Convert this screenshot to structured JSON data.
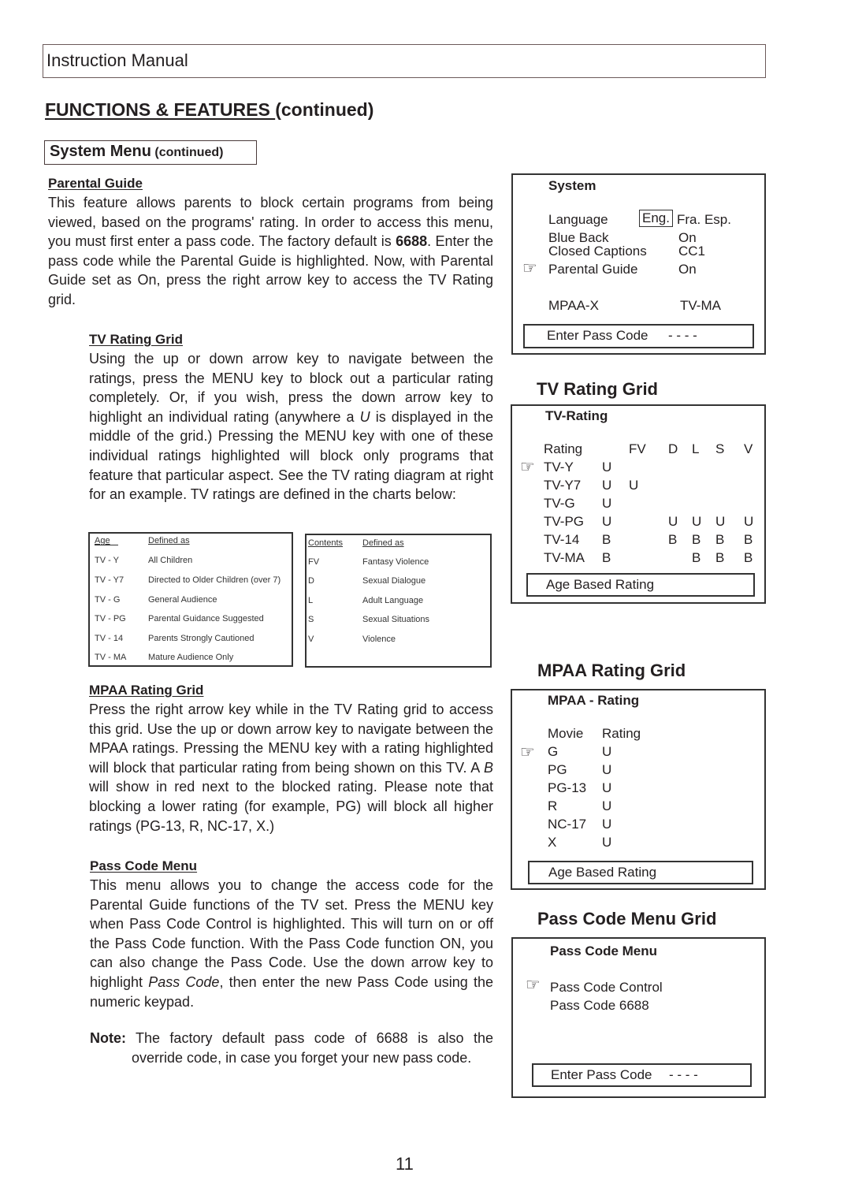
{
  "header": {
    "title": "Instruction Manual"
  },
  "page_title": {
    "main": "FUNCTIONS & FEATURES ",
    "suffix": "(continued)"
  },
  "section": {
    "title": "System Menu",
    "suffix": "(continued)"
  },
  "parental_guide": {
    "heading": "Parental Guide",
    "text_before": "This feature allows parents to block certain programs from being viewed, based on the programs' rating. In order to access this menu, you must first enter a pass code. The factory default is ",
    "default_code": "6688",
    "text_after": ". Enter the pass code while the Parental Guide is highlighted.  Now, with Parental Guide set as On, press the right arrow key to access the TV Rating grid."
  },
  "tv_rating_section": {
    "heading": "TV Rating Grid",
    "text_before": "Using the up or down arrow key to navigate between the ratings, press the MENU key to block out a particular rating completely. Or, if you wish, press the down arrow key to highlight an individual rating (anywhere a ",
    "italic": "U",
    "text_after": " is displayed in the middle of the grid.) Pressing the MENU key with one of these individual ratings highlighted will block only programs that feature that particular aspect. See the TV rating diagram at right for an example. TV ratings are defined in the charts below:"
  },
  "age_table": {
    "headers": [
      "Age",
      "Defined as"
    ],
    "rows": [
      [
        "TV - Y",
        "All Children"
      ],
      [
        "TV - Y7",
        "Directed to Older Children (over 7)"
      ],
      [
        "TV - G",
        "General Audience"
      ],
      [
        "TV - PG",
        "Parental Guidance Suggested"
      ],
      [
        "TV - 14",
        "Parents Strongly Cautioned"
      ],
      [
        "TV - MA",
        "Mature Audience Only"
      ]
    ]
  },
  "contents_table": {
    "headers": [
      "Contents",
      "Defined as"
    ],
    "rows": [
      [
        "FV",
        "Fantasy Violence"
      ],
      [
        "D",
        "Sexual Dialogue"
      ],
      [
        "L",
        "Adult Language"
      ],
      [
        "S",
        "Sexual Situations"
      ],
      [
        "V",
        "Violence"
      ]
    ]
  },
  "mpaa_section": {
    "heading": "MPAA Rating Grid",
    "text_before": "Press the right arrow key while in the TV Rating grid to access this grid. Use the up or down arrow key to navigate between the MPAA ratings. Pressing the MENU key with a rating highlighted will block that particular rating from being shown on this TV. A ",
    "italic": "B",
    "text_after": " will show in red next to the blocked rating. Please note that blocking a lower rating (for example, PG) will block all higher ratings (PG-13, R, NC-17, X.)"
  },
  "passcode_section": {
    "heading": "Pass Code Menu",
    "text_before": "This menu allows you to change the access code for the Parental Guide functions of the TV set. Press the MENU key when Pass Code Control is highlighted. This will turn on or off the Pass Code function. With the Pass Code function ON, you can also change the Pass Code. Use the down arrow key to highlight ",
    "italic": "Pass Code",
    "text_after": ", then enter the new Pass Code using the numeric keypad.",
    "note_label": "Note:",
    "note_line1": "The factory default pass code of 6688 is also the",
    "note_line2": "override code, in case you forget your new pass code."
  },
  "system_menu": {
    "title": "System",
    "language_label": "Language",
    "language_options": [
      "Eng.",
      "Fra. Esp."
    ],
    "blue_back": {
      "label": "Blue Back",
      "value": "On"
    },
    "closed_captions": {
      "label": "Closed Captions",
      "value": "CC1"
    },
    "parental_guide": {
      "label": "Parental Guide",
      "value": "On"
    },
    "mpaa_limit": "MPAA-X",
    "tv_limit": "TV-MA",
    "pass_code_prompt": "Enter Pass Code",
    "pass_code_value": "- - - -",
    "pointer_icon": "☞"
  },
  "tv_grid": {
    "title": "TV Rating Grid",
    "menu_title": "TV-Rating",
    "columns": [
      "Rating",
      "",
      "FV",
      "D",
      "L",
      "S",
      "V"
    ],
    "rows": [
      {
        "rating": "TV-Y",
        "age": "U",
        "FV": "",
        "D": "",
        "L": "",
        "S": "",
        "V": ""
      },
      {
        "rating": "TV-Y7",
        "age": "U",
        "FV": "U",
        "D": "",
        "L": "",
        "S": "",
        "V": ""
      },
      {
        "rating": "TV-G",
        "age": "U",
        "FV": "",
        "D": "",
        "L": "",
        "S": "",
        "V": ""
      },
      {
        "rating": "TV-PG",
        "age": "U",
        "FV": "",
        "D": "U",
        "L": "U",
        "S": "U",
        "V": "U"
      },
      {
        "rating": "TV-14",
        "age": "B",
        "FV": "",
        "D": "B",
        "L": "B",
        "S": "B",
        "V": "B"
      },
      {
        "rating": "TV-MA",
        "age": "B",
        "FV": "",
        "D": "",
        "L": "B",
        "S": "B",
        "V": "B"
      }
    ],
    "footer": "Age Based Rating",
    "pointer_icon": "☞"
  },
  "mpaa_grid": {
    "title": "MPAA Rating Grid",
    "menu_title": "MPAA - Rating",
    "columns": [
      "Movie",
      "Rating"
    ],
    "rows": [
      [
        "G",
        "U"
      ],
      [
        "PG",
        "U"
      ],
      [
        "PG-13",
        "U"
      ],
      [
        "R",
        "U"
      ],
      [
        "NC-17",
        "U"
      ],
      [
        "X",
        "U"
      ]
    ],
    "footer": "Age Based Rating",
    "pointer_icon": "☞"
  },
  "passcode_grid": {
    "title": "Pass Code Menu Grid",
    "menu_title": "Pass Code Menu",
    "items": [
      "Pass Code Control",
      "Pass Code 6688"
    ],
    "pass_code_prompt": "Enter Pass Code",
    "pass_code_value": "- - - -",
    "pointer_icon": "☞"
  },
  "page_number": "11"
}
